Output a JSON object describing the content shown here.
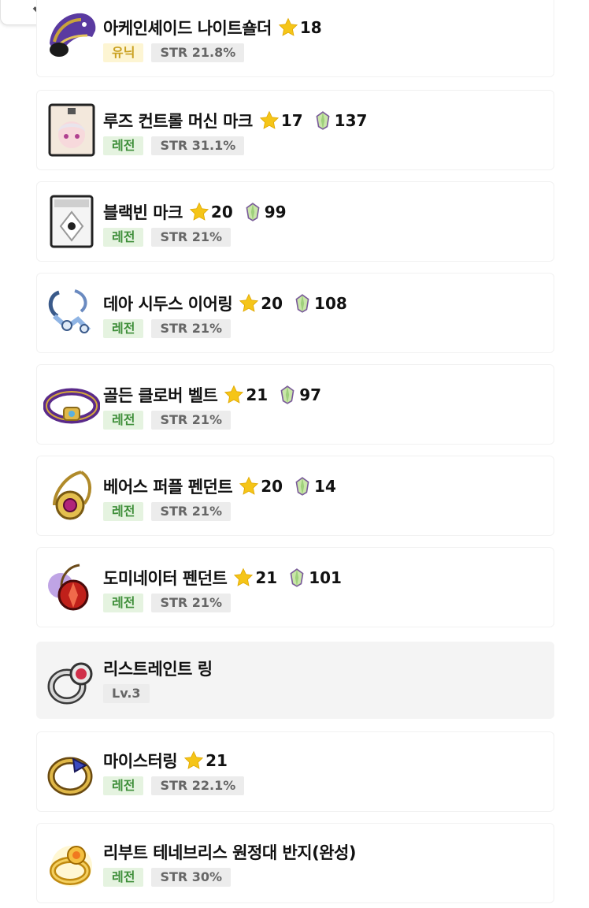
{
  "grade_colors": {
    "레전": "#3f8f3a",
    "유닉": "#c9a020"
  },
  "items": [
    {
      "name": "아케인셰이드 나이트숄더",
      "star": "18",
      "grade": "유닉",
      "grade_type": "unique",
      "stat": "STR 21.8%",
      "icon": "arcane-shoulder-icon"
    },
    {
      "name": "루즈 컨트롤 머신 마크",
      "star": "17",
      "gem": "137",
      "grade": "레전",
      "grade_type": "legend",
      "stat": "STR 31.1%",
      "icon": "loose-control-machine-mark-icon"
    },
    {
      "name": "블랙빈 마크",
      "star": "20",
      "gem": "99",
      "grade": "레전",
      "grade_type": "legend",
      "stat": "STR 21%",
      "icon": "blackbean-mark-icon"
    },
    {
      "name": "데아 시두스 이어링",
      "star": "20",
      "gem": "108",
      "grade": "레전",
      "grade_type": "legend",
      "stat": "STR 21%",
      "icon": "dea-sidus-earring-icon"
    },
    {
      "name": "골든 클로버 벨트",
      "star": "21",
      "gem": "97",
      "grade": "레전",
      "grade_type": "legend",
      "stat": "STR 21%",
      "icon": "golden-clover-belt-icon"
    },
    {
      "name": "베어스 퍼플 펜던트",
      "star": "20",
      "gem": "14",
      "grade": "레전",
      "grade_type": "legend",
      "stat": "STR 21%",
      "icon": "bears-purple-pendant-icon"
    },
    {
      "name": "도미네이터 펜던트",
      "star": "21",
      "gem": "101",
      "grade": "레전",
      "grade_type": "legend",
      "stat": "STR 21%",
      "icon": "dominator-pendant-icon"
    },
    {
      "name": "리스트레인트 링",
      "level": "Lv.3",
      "icon": "restraint-ring-icon"
    },
    {
      "name": "마이스터링",
      "star": "21",
      "grade": "레전",
      "grade_type": "legend",
      "stat": "STR 22.1%",
      "icon": "meister-ring-icon"
    },
    {
      "name": "리부트 테네브리스 원정대 반지(완성)",
      "grade": "레전",
      "grade_type": "legend",
      "stat": "STR 30%",
      "icon": "tenebris-ring-icon"
    }
  ]
}
